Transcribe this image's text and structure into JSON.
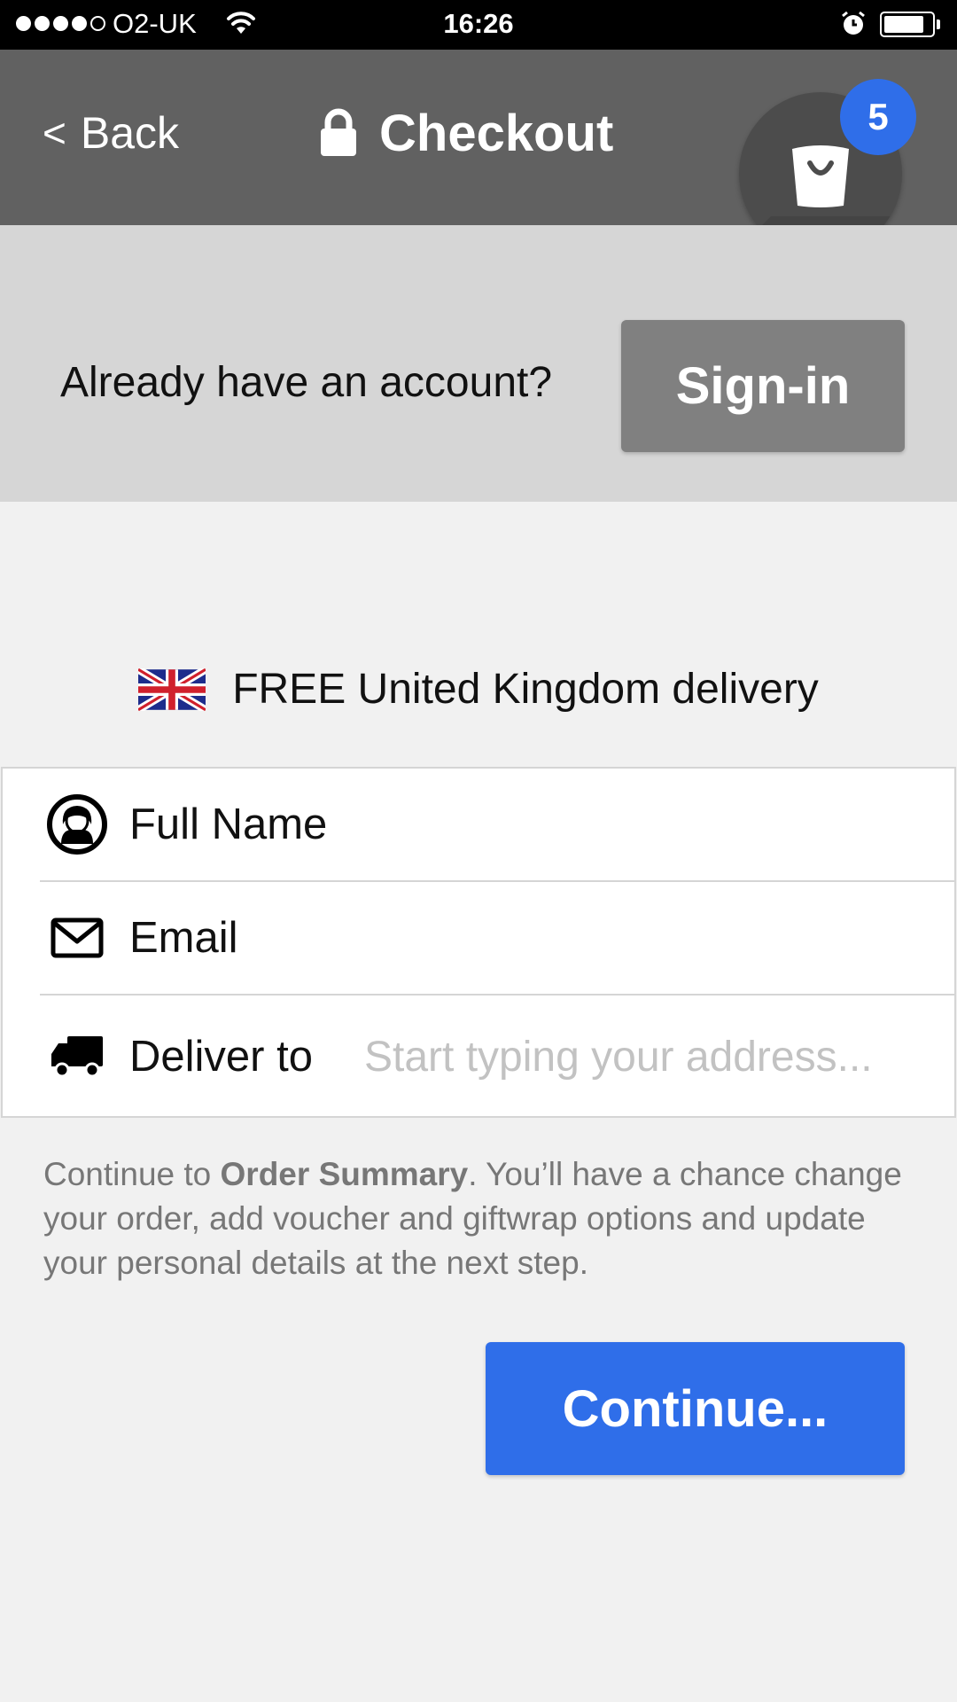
{
  "status_bar": {
    "carrier": "O2-UK",
    "time": "16:26",
    "signal_bars_filled": 4,
    "signal_bars_total": 5,
    "battery_level": 0.85
  },
  "header": {
    "back_label": "Back",
    "title": "Checkout",
    "cart_count": "5",
    "accent_color": "#2f6ee9"
  },
  "account": {
    "prompt": "Already have an account?",
    "signin_label": "Sign-in"
  },
  "delivery": {
    "note": "FREE United Kingdom delivery",
    "flag_icon": "uk-flag-icon"
  },
  "form": {
    "name_label": "Full Name",
    "email_label": "Email",
    "deliver_label": "Deliver to",
    "address_placeholder": "Start typing your address..."
  },
  "helper": {
    "prefix": "Continue to ",
    "bold": "Order Summary",
    "suffix": ". You’ll have a chance change your order, add voucher and giftwrap options and update your personal details at the next step."
  },
  "continue_label": "Continue..."
}
